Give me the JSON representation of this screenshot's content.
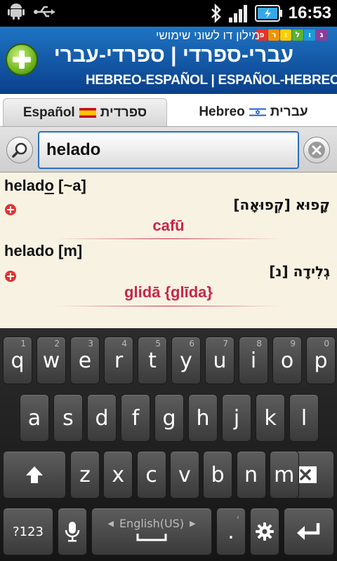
{
  "status_bar": {
    "time": "16:53",
    "icons": [
      "android-debug-icon",
      "usb-icon",
      "bluetooth-icon",
      "signal-icon",
      "battery-icon"
    ]
  },
  "header": {
    "brand_letters": [
      "פ",
      "ר",
      "ו",
      "ל",
      "ו",
      "ג"
    ],
    "brand_colors": [
      "#e5322d",
      "#f39200",
      "#ffcc00",
      "#5cb030",
      "#1d9ad6",
      "#8a3f9b"
    ],
    "subtitle": "מילון דו לשוני שימושי",
    "title": "עברי-ספרדי | ספרדי-עברי",
    "latin_title": "HEBREO-ESPAÑOL | ESPAÑOL-HEBREO"
  },
  "tabs": {
    "spanish": {
      "latin": "Español",
      "hebrew": "ספרדית"
    },
    "hebrew": {
      "latin": "Hebreo",
      "hebrew": "עברית"
    }
  },
  "search": {
    "value": "helado"
  },
  "results": [
    {
      "source_pre": "helad",
      "source_under": "o",
      "source_post": " [~a]",
      "hebrew": "קָפוּא [קְפוּאָה]",
      "translit": "cafū"
    },
    {
      "source_pre": "helado [m]",
      "source_under": "",
      "source_post": "",
      "hebrew": "גְלִידָה [נ]",
      "translit": "glidā {glīda}"
    }
  ],
  "keyboard": {
    "row1": [
      {
        "l": "q",
        "h": "1"
      },
      {
        "l": "w",
        "h": "2"
      },
      {
        "l": "e",
        "h": "3"
      },
      {
        "l": "r",
        "h": "4"
      },
      {
        "l": "t",
        "h": "5"
      },
      {
        "l": "y",
        "h": "6"
      },
      {
        "l": "u",
        "h": "7"
      },
      {
        "l": "i",
        "h": "8"
      },
      {
        "l": "o",
        "h": "9"
      },
      {
        "l": "p",
        "h": "0"
      }
    ],
    "row2": [
      "a",
      "s",
      "d",
      "f",
      "g",
      "h",
      "j",
      "k",
      "l"
    ],
    "row3": [
      "z",
      "x",
      "c",
      "v",
      "b",
      "n",
      "m"
    ],
    "symbols_label": "?123",
    "space_label": "English(US)",
    "period": ".",
    "comma_hint": ","
  }
}
